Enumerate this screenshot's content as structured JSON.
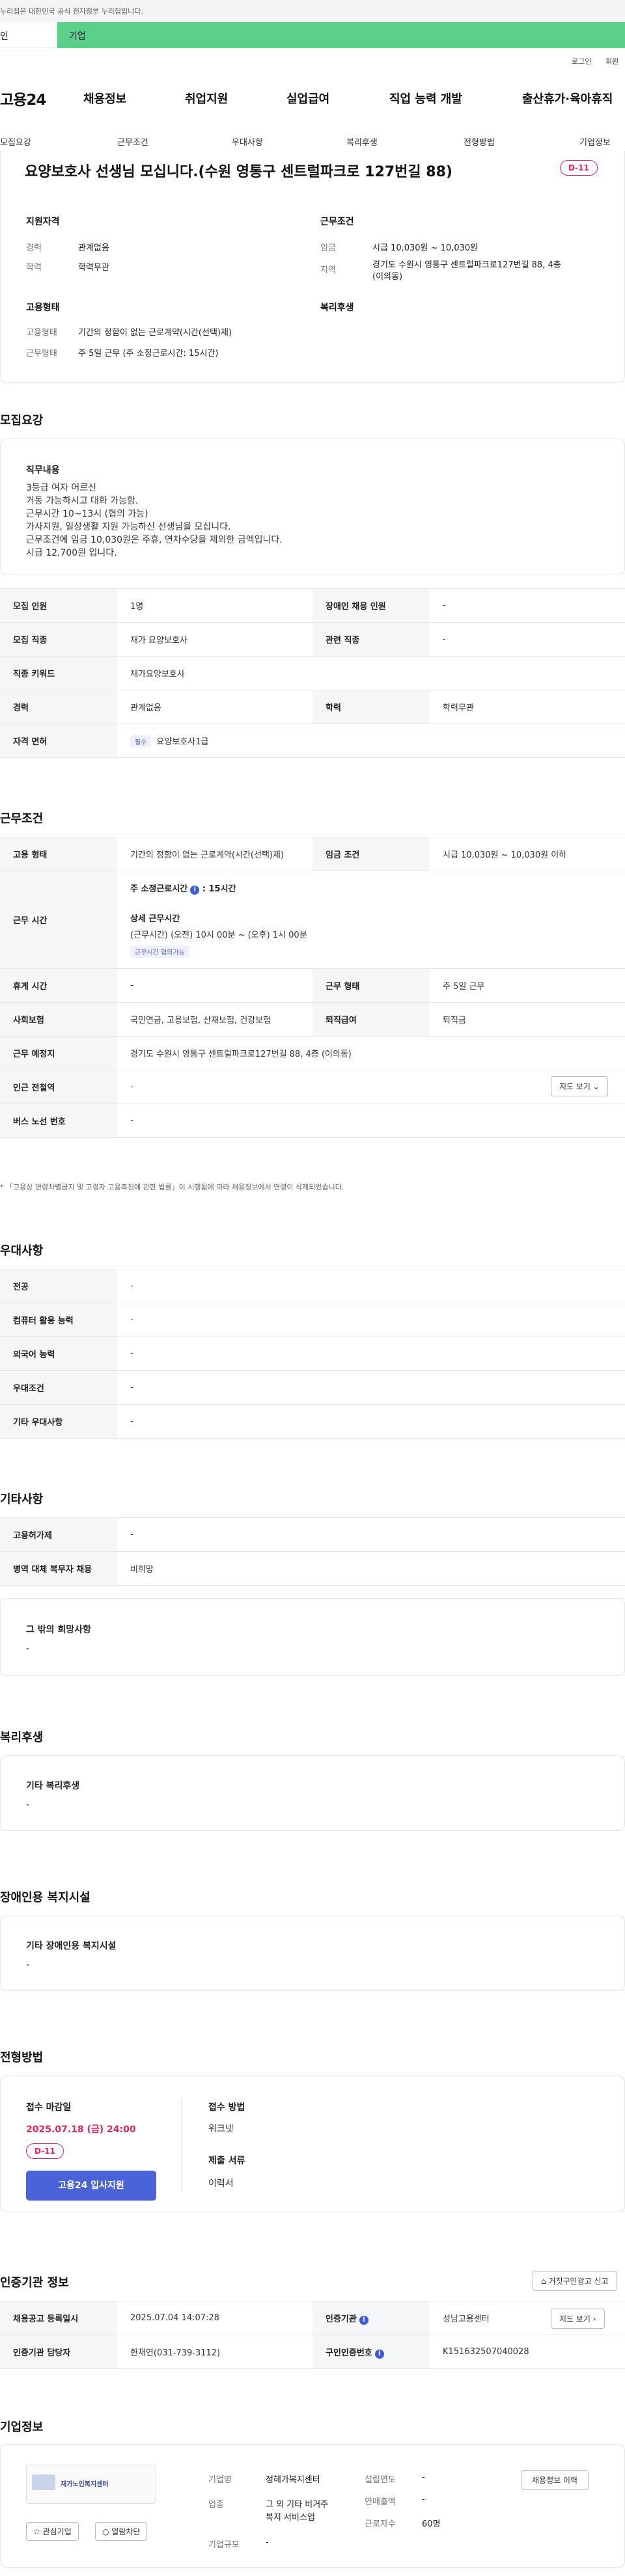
{
  "gov_bar": {
    "text": "누리집은 대한민국 공식 전자정부 누리집입니다."
  },
  "audience": {
    "tab_personal": "인",
    "tab_company": "기업"
  },
  "util": {
    "login": "로그인",
    "join": "회원"
  },
  "gnb": {
    "logo": "고용24",
    "menus": [
      "채용정보",
      "취업지원",
      "실업급여",
      "직업 능력 개발",
      "출산휴가·육아휴직"
    ]
  },
  "subnav": [
    "모집요강",
    "근무조건",
    "우대사항",
    "복리후생",
    "전형방법",
    "기업정보"
  ],
  "job": {
    "title": "요양보호사 선생님 모십니다.(수원 영통구 센트럴파크로 127번길 88)",
    "dday": "D-11"
  },
  "summary": {
    "qual_title": "지원자격",
    "career_k": "경력",
    "career_v": "관계없음",
    "edu_k": "학력",
    "edu_v": "학력무관",
    "cond_title": "근무조건",
    "wage_k": "임금",
    "wage_v": "시급 10,030원 ~ 10,030원",
    "area_k": "지역",
    "area_v1": "경기도 수원시 영통구 센트럴파크로127번길 88, 4층",
    "area_v2": "(이의동)",
    "emp_title": "고용형태",
    "emp_k": "고용형태",
    "emp_v": "기간의 정함이 없는 근로계약(시간(선택)제)",
    "form_k": "근무형태",
    "form_v": "주 5일 근무 (주 소정근로시간: 15시간)",
    "welfare_title": "복리후생"
  },
  "recruit": {
    "section_title": "모집요강",
    "duty_label": "직무내용",
    "duty_lines": [
      "3등급 여자 어르신",
      "거동 가능하시고 대화 가능함.",
      "근무시간 10~13시 (협의 가능)",
      "가사지원, 일상생활 지원 가능하신 선생님을 모십니다.",
      "근무조건에 임금 10,030원은 주휴, 연차수당을 제외한 금액입니다.",
      "시급 12,700원 입니다."
    ],
    "rows": {
      "count_k": "모집 인원",
      "count_v": "1명",
      "disabled_k": "장애인 채용 인원",
      "disabled_v": "-",
      "job_k": "모집 직종",
      "job_v": "재가 요양보호사",
      "related_k": "관련 직종",
      "related_v": "-",
      "keyword_k": "직종 키워드",
      "keyword_v": "재가요양보호사",
      "career_k": "경력",
      "career_v": "관계없음",
      "edu_k": "학력",
      "edu_v": "학력무관",
      "license_k": "자격 면허",
      "license_tag": "필수",
      "license_v": "요양보호사1급"
    }
  },
  "conditions": {
    "section_title": "근무조건",
    "emp_k": "고용 형태",
    "emp_v": "기간의 정함이 없는 근로계약(시간(선택)제)",
    "wage_k": "임금 조건",
    "wage_v": "시급 10,030원 ~ 10,030원 이하",
    "time_k": "근무 시간",
    "weekly_label": "주 소정근로시간",
    "weekly_value": ": 15시간",
    "detail_label": "상세 근무시간",
    "detail_value": "(근무시간) (오전) 10시 00분 ~ (오후) 1시 00분",
    "detail_tag": "근무시간 협의가능",
    "rest_k": "휴게 시간",
    "rest_v": "-",
    "form_k": "근무 형태",
    "form_v": "주 5일 근무",
    "insure_k": "사회보험",
    "insure_v": "국민연금, 고용보험, 산재보험, 건강보험",
    "retire_k": "퇴직급여",
    "retire_v": "퇴직금",
    "place_k": "근무 예정지",
    "place_v": "경기도 수원시 영통구 센트럴파크로127번길 88, 4층 (이의동)",
    "map_btn": "지도 보기 ⌄",
    "subway_k": "인근 전철역",
    "subway_v": "-",
    "bus_k": "버스 노선 번호",
    "bus_v": "-",
    "note": "* 「고용상 연령차별금지 및 고령자 고용촉진에 관한 법률」이 시행됨에 따라 채용정보에서 연령이 삭제되었습니다."
  },
  "preference": {
    "section_title": "우대사항",
    "major_k": "전공",
    "major_v": "-",
    "pc_k": "컴퓨터 활용 능력",
    "pc_v": "-",
    "lang_k": "외국어 능력",
    "lang_v": "-",
    "cond_k": "우대조건",
    "cond_v": "-",
    "etc_k": "기타 우대사항",
    "etc_v": "-"
  },
  "other": {
    "section_title": "기타사항",
    "permit_k": "고용허가제",
    "permit_v": "-",
    "military_k": "병역 대체 복무자 채용",
    "military_v": "비희망",
    "hope_label": "그 밖의 희망사항",
    "hope_v": "-"
  },
  "welfare": {
    "section_title": "복리후생",
    "label": "기타 복리후생",
    "value": "-"
  },
  "disabled_fac": {
    "section_title": "장애인용 복지시설",
    "label": "기타 장애인용 복지시설",
    "value": "-"
  },
  "selection": {
    "section_title": "전형방법",
    "deadline_label": "접수 마감일",
    "deadline_value": "2025.07.18 (금) 24:00",
    "dday": "D-11",
    "apply_btn": "고용24 입사지원",
    "method_label": "접수 방법",
    "method_value": "워크넷",
    "docs_label": "제출 서류",
    "docs_value": "이력서"
  },
  "agency": {
    "section_title": "인증기관 정보",
    "report_btn": "거짓구인광고 신고",
    "reg_k": "채용공고 등록일시",
    "reg_v": "2025.07.04 14:07:28",
    "agency_k": "인증기관",
    "agency_v": "성남고용센터",
    "map_btn": "지도 보기 ›",
    "manager_k": "인증기관 담당자",
    "manager_v": "한채연(031-739-3112)",
    "cert_k": "구인인증번호",
    "cert_v": "K151632507040028"
  },
  "company": {
    "section_title": "기업정보",
    "logo_text": "재가노인복지센터",
    "interest_btn": "☆ 관심기업",
    "block_btn": "○ 열람차단",
    "name_k": "기업명",
    "name_v": "정혜가복지센터",
    "industry_k": "업종",
    "industry_v1": "그 외 기타 비거주",
    "industry_v2": "복지 서비스업",
    "size_k": "기업규모",
    "size_v": "-",
    "founded_k": "설립연도",
    "founded_v": "-",
    "sales_k": "연매출액",
    "sales_v": "-",
    "staff_k": "근로자수",
    "staff_v": "60명",
    "history_btn": "채용정보 이력"
  },
  "colors": {
    "accent": "#4a63d8",
    "dday": "#e0245e",
    "audience_green": "#5bd08a"
  }
}
